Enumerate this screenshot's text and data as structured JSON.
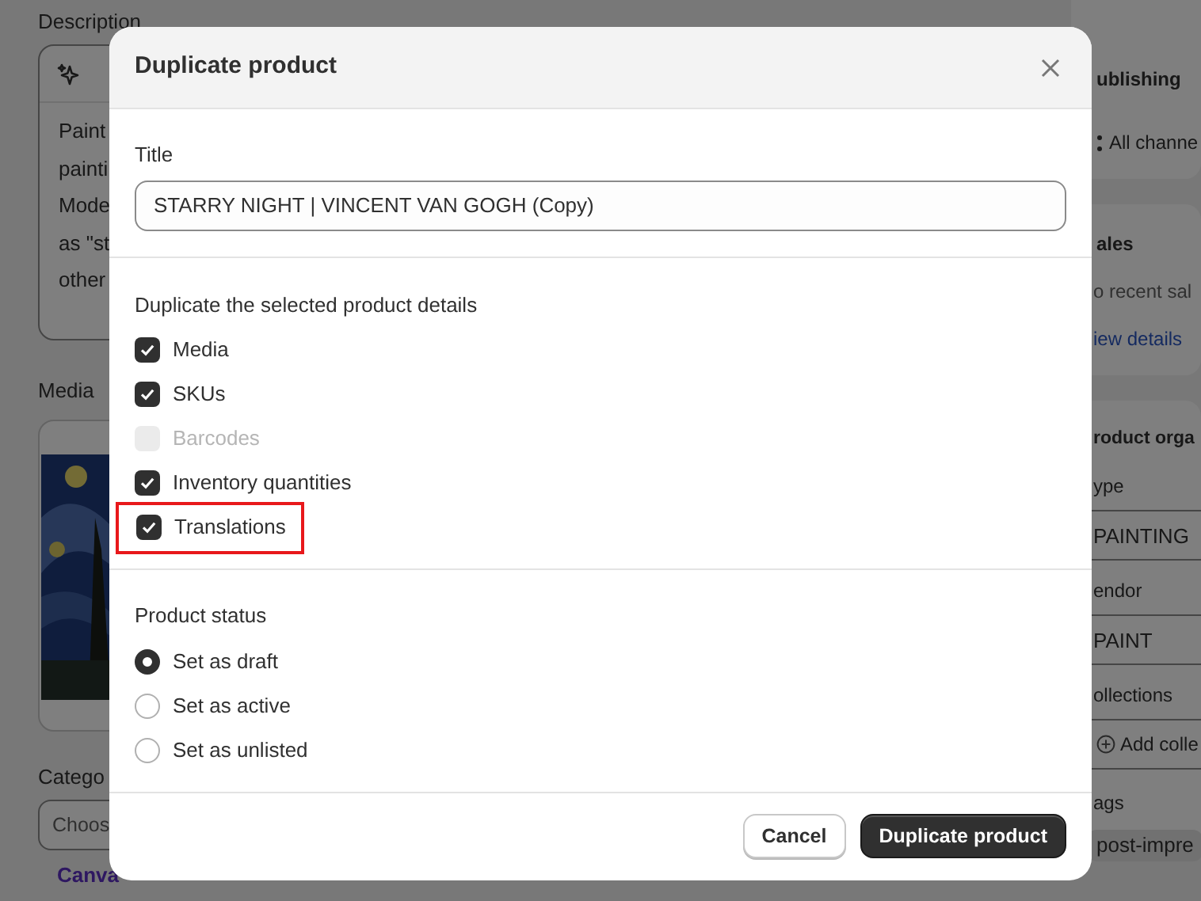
{
  "background": {
    "left": {
      "description_label": "Description",
      "description_lines": [
        "Paint",
        "painti",
        "Mode",
        "as \"st",
        "other"
      ],
      "media_label": "Media",
      "category_label": "Catego",
      "category_placeholder": "Choos",
      "category_suggestion": "Canva"
    },
    "right": {
      "publishing_title": "ublishing",
      "publishing_channels": "All channe",
      "sales_title": "ales",
      "sales_text": "o recent sal",
      "sales_link": "iew details",
      "organization_title": "roduct orga",
      "type_label": "ype",
      "type_value": "PAINTING",
      "vendor_label": "endor",
      "vendor_value": "PAINT",
      "collections_label": "ollections",
      "collections_add": "Add colle",
      "tags_label": "ags",
      "tag": "post-impre"
    }
  },
  "dialog": {
    "title": "Duplicate product",
    "title_field": {
      "label": "Title",
      "value": "STARRY NIGHT | VINCENT VAN GOGH (Copy)"
    },
    "details": {
      "heading": "Duplicate the selected product details",
      "options": [
        {
          "label": "Media",
          "checked": true,
          "disabled": false,
          "highlighted": false
        },
        {
          "label": "SKUs",
          "checked": true,
          "disabled": false,
          "highlighted": false
        },
        {
          "label": "Barcodes",
          "checked": false,
          "disabled": true,
          "highlighted": false
        },
        {
          "label": "Inventory quantities",
          "checked": true,
          "disabled": false,
          "highlighted": false
        },
        {
          "label": "Translations",
          "checked": true,
          "disabled": false,
          "highlighted": true
        }
      ]
    },
    "status": {
      "heading": "Product status",
      "options": [
        {
          "label": "Set as draft",
          "selected": true
        },
        {
          "label": "Set as active",
          "selected": false
        },
        {
          "label": "Set as unlisted",
          "selected": false
        }
      ]
    },
    "buttons": [
      {
        "label": "Cancel",
        "kind": "secondary"
      },
      {
        "label": "Duplicate product",
        "kind": "primary"
      }
    ]
  }
}
